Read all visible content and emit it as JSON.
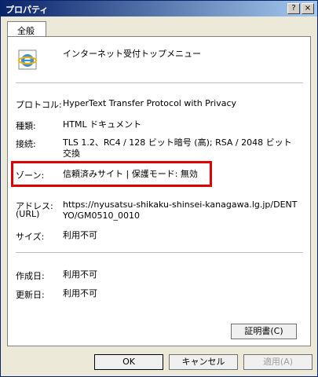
{
  "window": {
    "title": "プロパティ",
    "help": "?",
    "close": "×"
  },
  "tab": "全般",
  "page_name": "インターネット受付トップメニュー",
  "fields": {
    "protocol": {
      "label": "プロトコル:",
      "value": "HyperText Transfer Protocol with Privacy"
    },
    "type": {
      "label": "種類:",
      "value": "HTML ドキュメント"
    },
    "connection": {
      "label": "接続:",
      "value": "TLS 1.2、RC4 / 128 ビット暗号 (高); RSA / 2048 ビット交換"
    },
    "zone": {
      "label": "ゾーン:",
      "value": "信頼済みサイト | 保護モード: 無効"
    },
    "address": {
      "label": "アドレス:",
      "label2": "(URL)",
      "value": "https://nyusatsu-shikaku-shinsei-kanagawa.lg.jp/DENTYO/GM0510_0010"
    },
    "size": {
      "label": "サイズ:",
      "value": "利用不可"
    },
    "created": {
      "label": "作成日:",
      "value": "利用不可"
    },
    "updated": {
      "label": "更新日:",
      "value": "利用不可"
    }
  },
  "buttons": {
    "certificate": "証明書(C)",
    "ok": "OK",
    "cancel": "キャンセル",
    "apply": "適用(A)"
  },
  "colors": {
    "highlight": "#e00000",
    "titlebar": "#0a246a"
  },
  "icons": {
    "page": "ie-page-icon"
  }
}
